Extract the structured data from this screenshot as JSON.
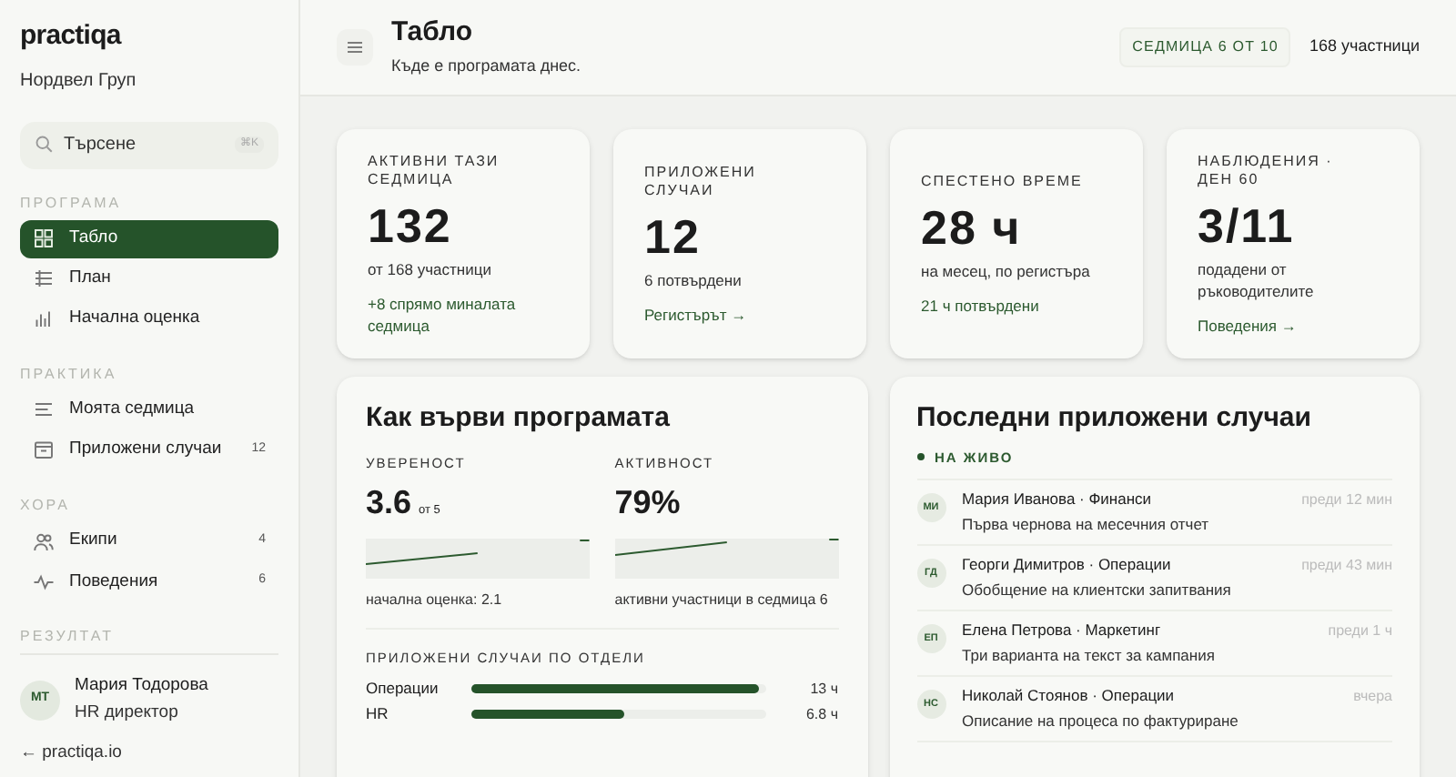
{
  "sidebar": {
    "logo": "practiqa",
    "org": "Нордвел Груп",
    "search": {
      "placeholder": "Търсене",
      "shortcut": "⌘K"
    },
    "sections": [
      {
        "title": "ПРОГРАМА",
        "items": [
          {
            "label": "Табло",
            "kind": "grid",
            "selected": true
          },
          {
            "label": "План",
            "kind": "list",
            "selected": false
          },
          {
            "label": "Начална оценка",
            "kind": "bars",
            "selected": false
          }
        ]
      },
      {
        "title": "ПРАКТИКА",
        "items": [
          {
            "label": "Моята седмица",
            "kind": "lines",
            "selected": false
          },
          {
            "label": "Приложени случаи",
            "kind": "calendar",
            "selected": false,
            "count": "12"
          }
        ]
      },
      {
        "title": "ХОРА",
        "items": [
          {
            "label": "Екипи",
            "kind": "people",
            "selected": false,
            "count": "4"
          },
          {
            "label": "Поведения",
            "kind": "pulse",
            "selected": false,
            "count": "6"
          }
        ]
      },
      {
        "title": "РЕЗУЛТАТ"
      }
    ],
    "user": {
      "initials": "МТ",
      "name": "Мария Тодорова",
      "role": "HR директор"
    },
    "link": "← practiqa.io"
  },
  "header": {
    "title": "Табло",
    "subtitle": "Къде е програмата днес.",
    "week_badge": "СЕДМИЦА 6 ОТ 10",
    "participants": "168 участници"
  },
  "stats": [
    {
      "label": "АКТИВНИ ТАЗИ СЕДМИЦА",
      "value": "132",
      "note": "от 168 участници",
      "link": "+8 спрямо миналата седмица"
    },
    {
      "label": "ПРИЛОЖЕНИ СЛУЧАИ",
      "value": "12",
      "note": "6 потвърдени",
      "link": "Регистърът →"
    },
    {
      "label": "СПЕСТЕНО ВРЕМЕ",
      "value": "28 ч",
      "note": "на месец, по регистъра",
      "link": "21 ч потвърдени"
    },
    {
      "label": "НАБЛЮДЕНИЯ · ДЕН 60",
      "value": "3/11",
      "note": "подадени от ръководителите",
      "link": "Поведения →"
    }
  ],
  "progress": {
    "title": "Как върви програмата",
    "metrics": [
      {
        "label": "УВЕРЕНОСТ",
        "value": "3.6",
        "unit": "от 5",
        "caption": "начална оценка: 2.1"
      },
      {
        "label": "АКТИВНОСТ",
        "value": "79%",
        "caption": "активни участници в седмица 6"
      }
    ],
    "departments_title": "ПРИЛОЖЕНИ СЛУЧАИ ПО ОТДЕЛИ",
    "departments": [
      {
        "name": "Операции",
        "level": 0.98,
        "reading": "13 ч"
      },
      {
        "name": "HR",
        "level": 0.52,
        "reading": "6.8 ч"
      }
    ]
  },
  "recent": {
    "title": "Последни приложени случаи",
    "live": "НА ЖИВО",
    "items": [
      {
        "initials": "МИ",
        "who": "Мария Иванова · Финанси",
        "what": "Първа чернова на месечния отчет",
        "when": "преди 12 мин"
      },
      {
        "initials": "ГД",
        "who": "Георги Димитров · Операции",
        "what": "Обобщение на клиентски запитвания",
        "when": "преди 43 мин"
      },
      {
        "initials": "ЕП",
        "who": "Елена Петрова · Маркетинг",
        "what": "Три варианта на текст за кампания",
        "when": "преди 1 ч"
      },
      {
        "initials": "НС",
        "who": "Николай Стоянов · Операции",
        "what": "Описание на процеса по фактуриране",
        "when": "вчера"
      }
    ]
  }
}
